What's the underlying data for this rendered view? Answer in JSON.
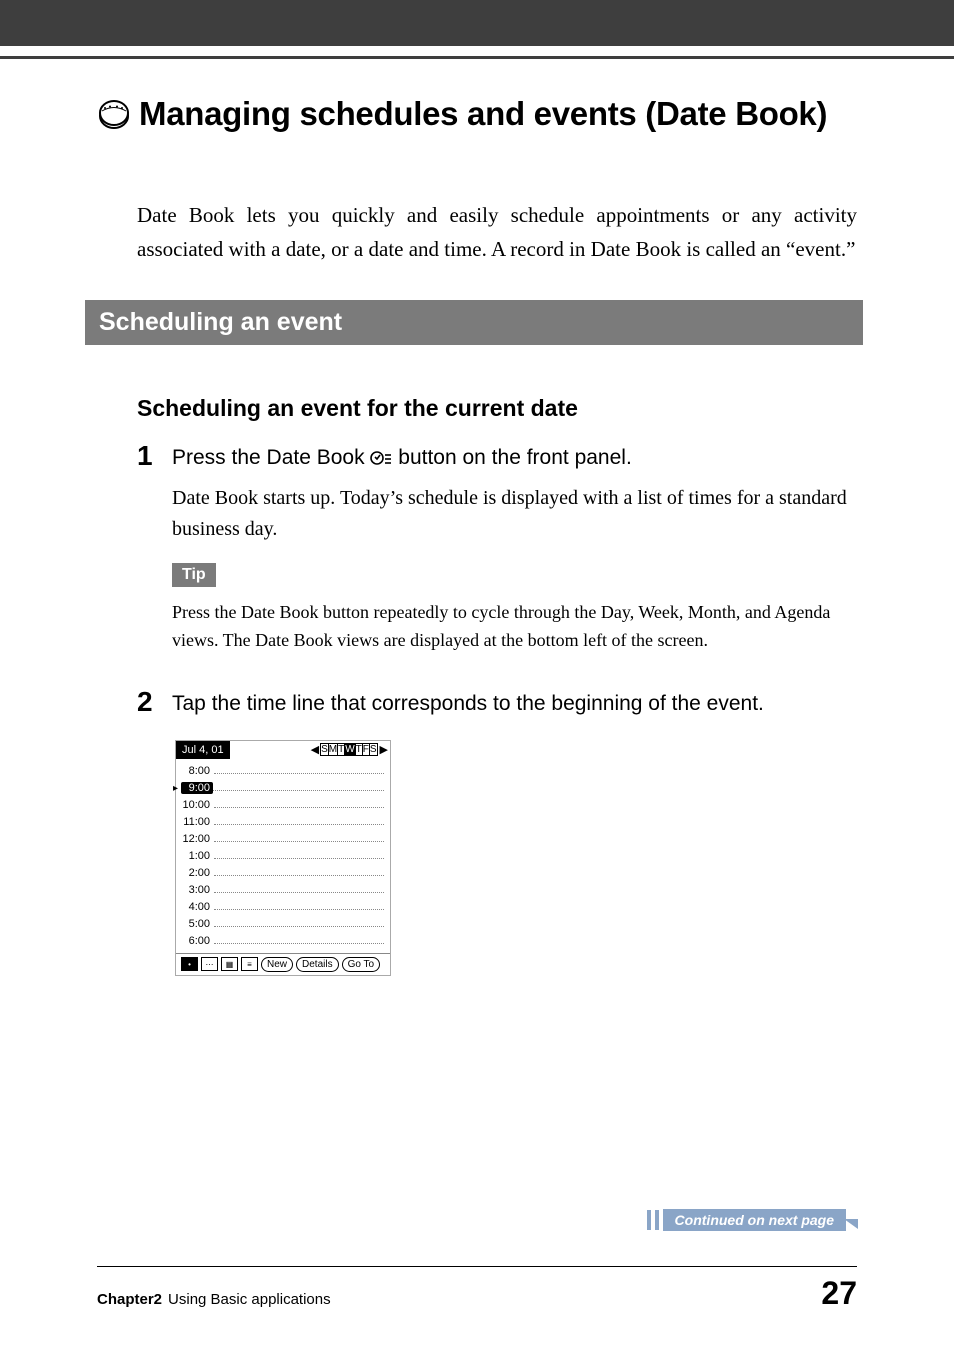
{
  "header": {
    "title": "Managing schedules and events (Date Book)"
  },
  "intro": "Date Book lets you quickly and easily schedule appointments or any activity associated with a date, or a date and time. A record in Date Book is called an “event.”",
  "section": {
    "title": "Scheduling an event"
  },
  "subheading": "Scheduling an event for the current date",
  "steps": [
    {
      "num": "1",
      "head_before": "Press the Date Book ",
      "head_after": " button on the front panel.",
      "desc": "Date Book starts up. Today’s schedule is displayed with a list of times for a standard business day.",
      "tip_label": "Tip",
      "tip_text": "Press the Date Book button repeatedly to cycle through the Day, Week, Month, and Agenda views. The Date Book views are displayed at the bottom left of the screen."
    },
    {
      "num": "2",
      "head": "Tap the time line that corresponds to the beginning of the event."
    }
  ],
  "datebook": {
    "date_label": "Jul 4, 01",
    "nav_left": "◀",
    "nav_right": "▶",
    "days": [
      "S",
      "M",
      "T",
      "W",
      "T",
      "F",
      "S"
    ],
    "current_day_index": 3,
    "times": [
      "8:00",
      "9:00",
      "10:00",
      "11:00",
      "12:00",
      "1:00",
      "2:00",
      "3:00",
      "4:00",
      "5:00",
      "6:00"
    ],
    "selected_time_index": 1,
    "buttons": {
      "new": "New",
      "details": "Details",
      "goto": "Go To"
    }
  },
  "continued": "Continued on next page",
  "footer": {
    "chapter": "Chapter2",
    "chapter_desc": "Using Basic applications",
    "page": "27"
  }
}
